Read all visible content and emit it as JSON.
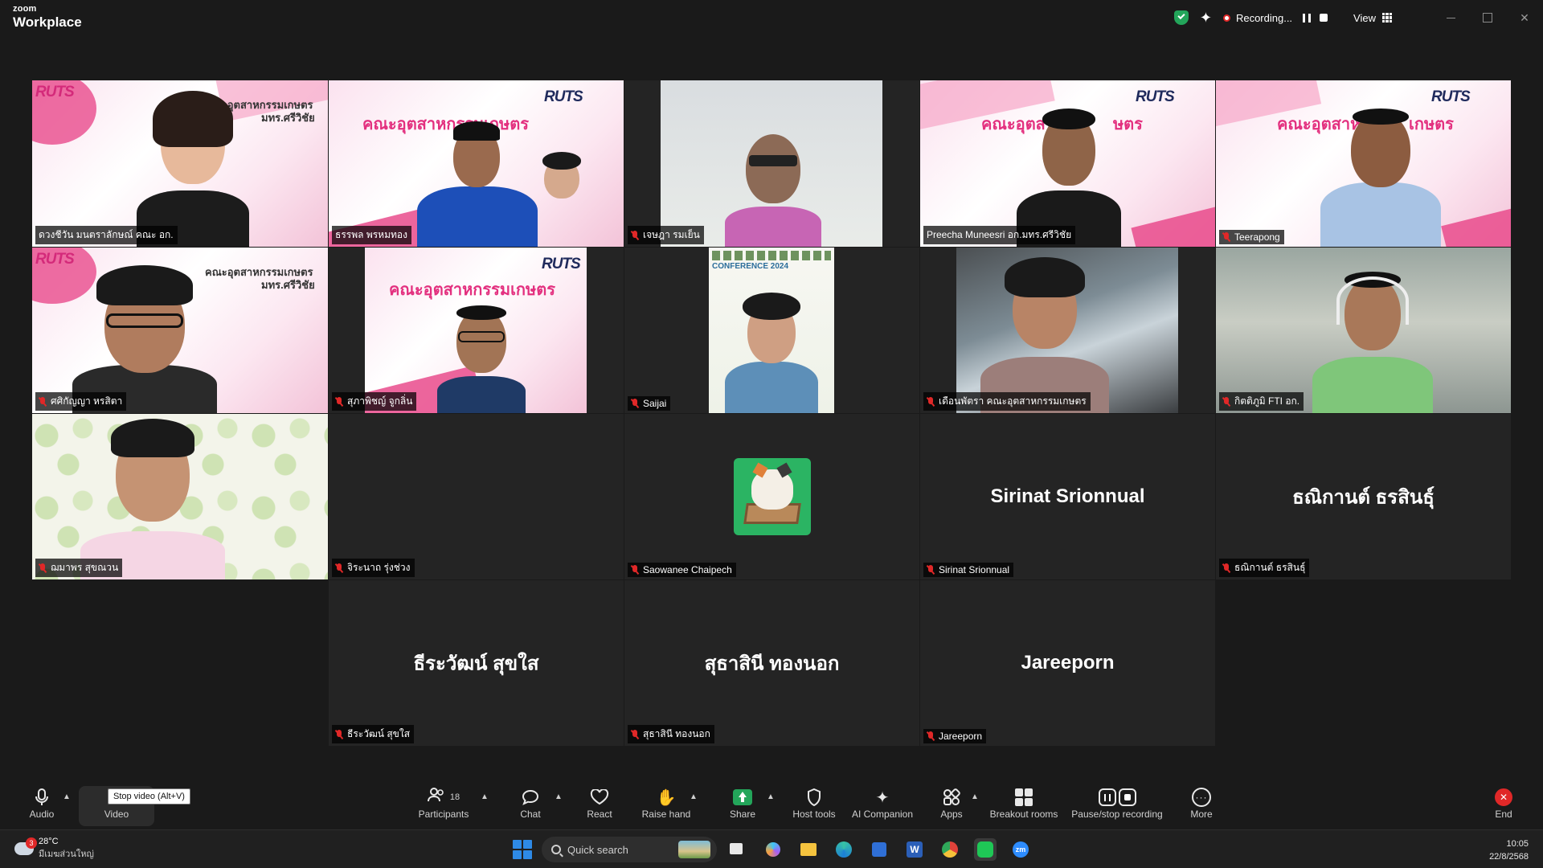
{
  "app": {
    "brand_small": "zoom",
    "brand_big": "Workplace"
  },
  "titlebar": {
    "recording_label": "Recording...",
    "view_label": "View"
  },
  "participants": [
    {
      "name": "ดวงชีวัน มนตราลักษณ์ คณะ อก.",
      "muted": false,
      "kind": "video"
    },
    {
      "name": "ธรรพล พรหมทอง",
      "muted": false,
      "kind": "video"
    },
    {
      "name": "เจษฎา รมเย็น",
      "muted": true,
      "kind": "video"
    },
    {
      "name": "Preecha Muneesri อก.มทร.ศรีวิชัย",
      "muted": false,
      "kind": "video"
    },
    {
      "name": "Teerapong",
      "muted": true,
      "kind": "video"
    },
    {
      "name": "ศศิกัญญา หรสิตา",
      "muted": true,
      "kind": "video"
    },
    {
      "name": "สุภาพิชญ์ จูกลิ่น",
      "muted": true,
      "kind": "video"
    },
    {
      "name": "Saijai",
      "muted": true,
      "kind": "video"
    },
    {
      "name": "เดือนพัตรา คณะอุตสาหกรรมเกษตร",
      "muted": true,
      "kind": "video"
    },
    {
      "name": "กิตติภูมิ FTI อก.",
      "muted": true,
      "kind": "video"
    },
    {
      "name": "ฌมาพร สุขณวน",
      "muted": true,
      "kind": "video"
    },
    {
      "name": "จิระนาถ รุ่งช่วง",
      "muted": true,
      "kind": "blank"
    },
    {
      "name": "Saowanee Chaipech",
      "muted": true,
      "kind": "avatar"
    },
    {
      "name": "Sirinat Srionnual",
      "muted": true,
      "kind": "name",
      "display": "Sirinat Srionnual"
    },
    {
      "name": "ธณิกานต์ ธรสินธุ์",
      "muted": true,
      "kind": "name",
      "display": "ธณิกานต์ ธรสินธุ์"
    },
    {
      "name": "ธีระวัฒน์ สุขใส",
      "muted": true,
      "kind": "name",
      "display": "ธีระวัฒน์ สุขใส"
    },
    {
      "name": "สุธาสินี ทองนอก",
      "muted": true,
      "kind": "name",
      "display": "สุธาสินี ทองนอก"
    },
    {
      "name": "Jareeporn",
      "muted": true,
      "kind": "name",
      "display": "Jareeporn"
    }
  ],
  "slide_text": {
    "logo": "RUTS",
    "heading": "คณะอุตสาหกรรมเกษตร",
    "heading_short": "คณะอุตสาห",
    "heading_tail": "เกษตร",
    "heading_mid": "ษตร",
    "sub": "มทร.ศรีวิชัย",
    "poster_title": "CONFERENCE 2024"
  },
  "toolbar": {
    "audio": "Audio",
    "video": "Video",
    "tooltip": "Stop video (Alt+V)",
    "participants": "Participants",
    "participants_count": "18",
    "chat": "Chat",
    "react": "React",
    "raise_hand": "Raise hand",
    "share": "Share",
    "host_tools": "Host tools",
    "ai_companion": "AI Companion",
    "apps": "Apps",
    "breakout_rooms": "Breakout rooms",
    "pause_stop_recording": "Pause/stop recording",
    "more": "More",
    "end": "End"
  },
  "taskbar": {
    "weather_temp": "28°C",
    "weather_desc": "มีเมฆส่วนใหญ่",
    "weather_badge": "3",
    "search_placeholder": "Quick search",
    "time": "10:05",
    "date": "22/8/2568"
  },
  "colors": {
    "accent_green": "#23d18b",
    "muted_red": "#e02828",
    "brand_pink": "#e3307f"
  }
}
